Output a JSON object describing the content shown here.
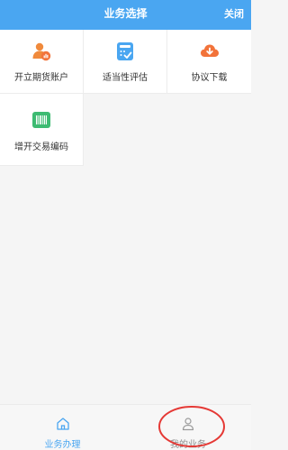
{
  "header": {
    "title": "业务选择",
    "close_label": "关闭"
  },
  "tiles": [
    {
      "label": "开立期货账户",
      "icon": "person-chart-icon",
      "color": "#f08a3c"
    },
    {
      "label": "适当性评估",
      "icon": "calculator-check-icon",
      "color": "#4aa6f1"
    },
    {
      "label": "协议下载",
      "icon": "cloud-download-icon",
      "color": "#f2733a"
    },
    {
      "label": "增开交易编码",
      "icon": "barcode-icon",
      "color": "#3dbb72"
    }
  ],
  "tabbar": {
    "items": [
      {
        "label": "业务办理",
        "icon": "home-icon",
        "state": "active"
      },
      {
        "label": "我的业务",
        "icon": "user-icon",
        "state": "inactive"
      }
    ]
  },
  "theme": {
    "primary": "#4aa6f1",
    "annotation": "#e53935"
  }
}
